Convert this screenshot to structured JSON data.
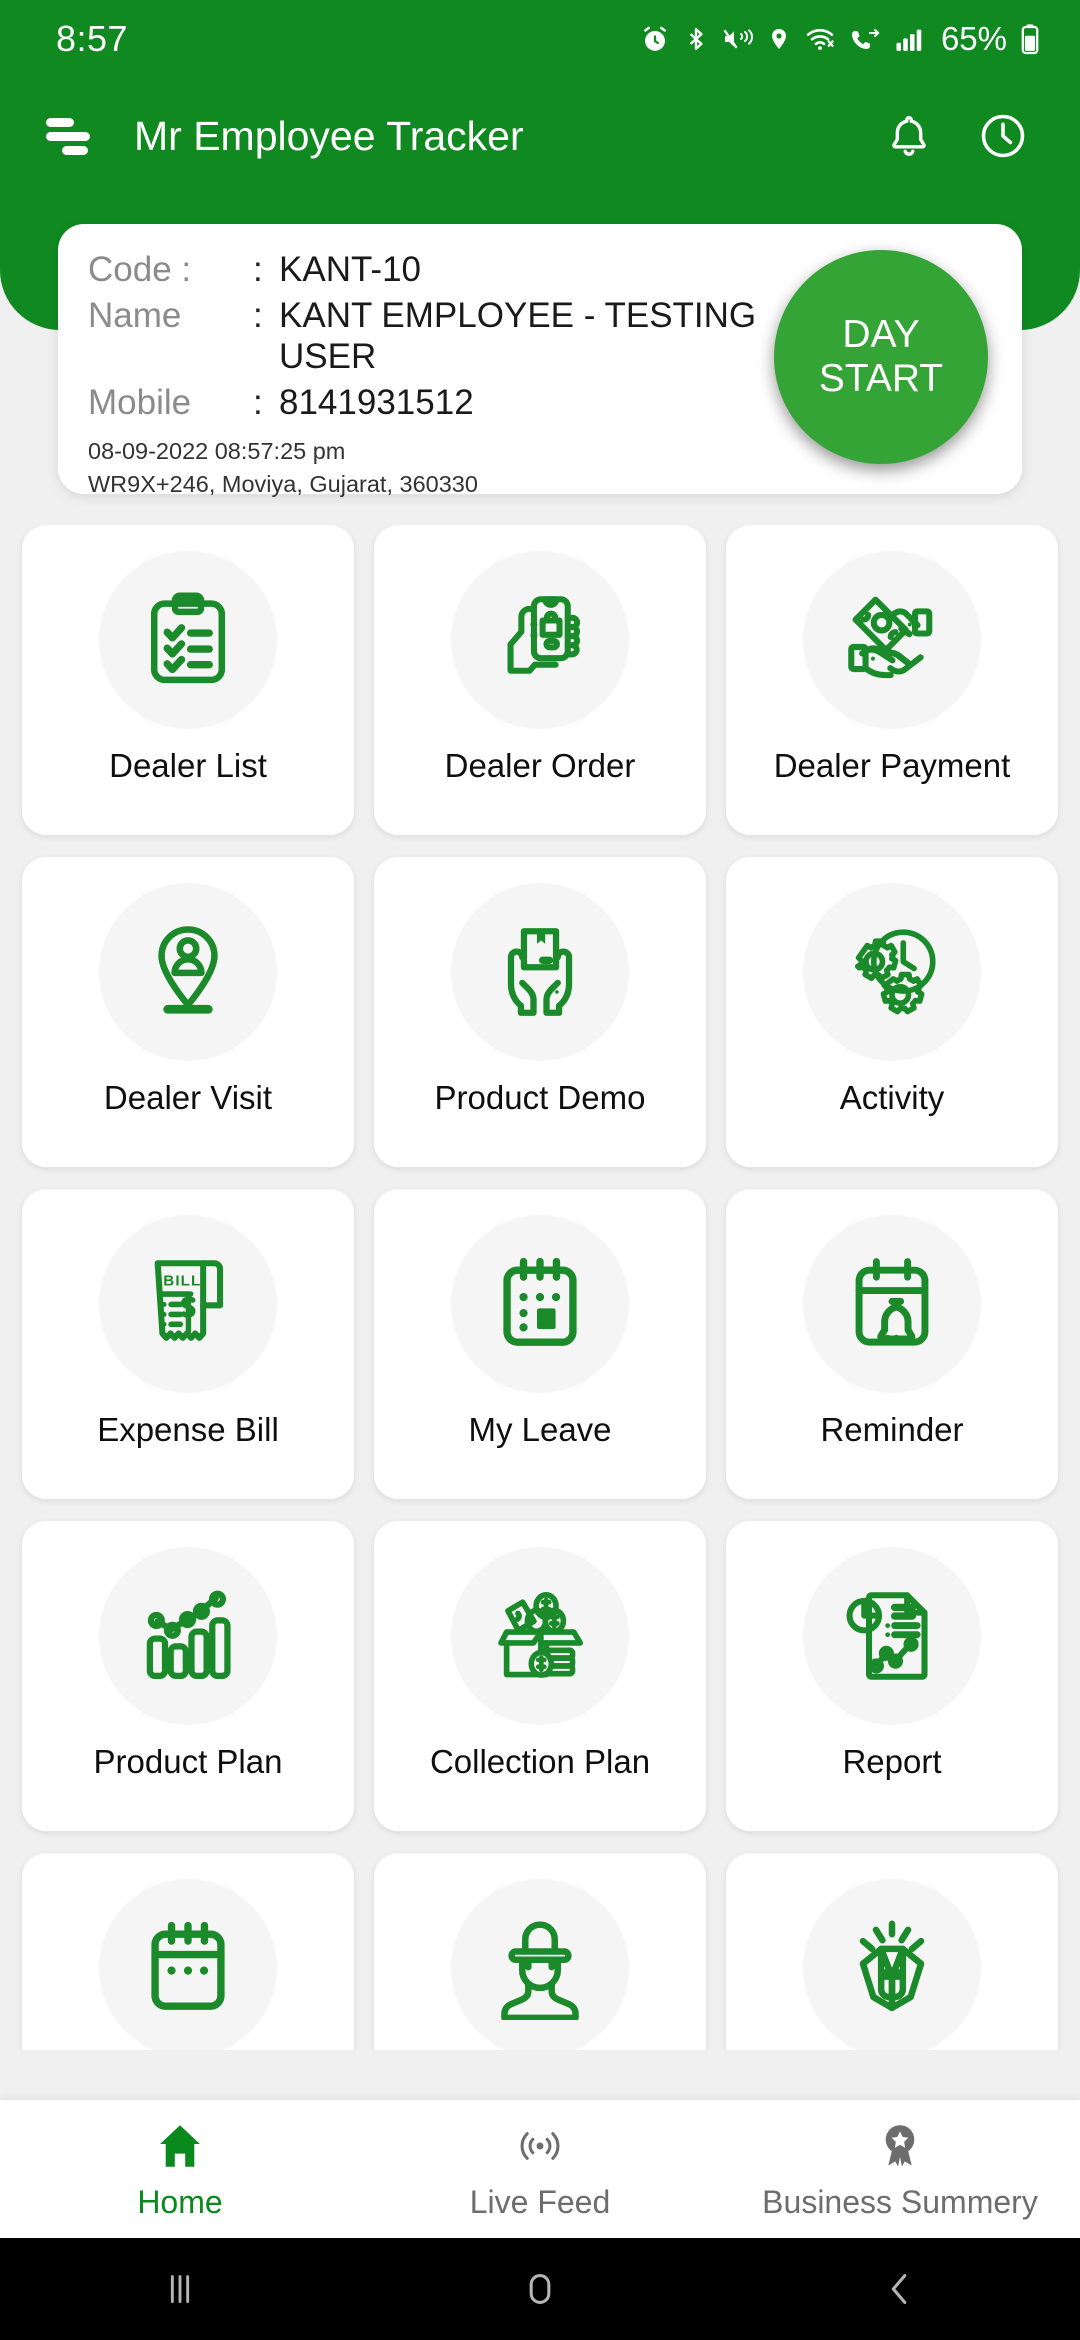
{
  "status_bar": {
    "time": "8:57",
    "battery_percent": "65%",
    "icons": [
      "alarm-icon",
      "bluetooth-icon",
      "mute-vibrate-icon",
      "location-icon",
      "wifi-icon",
      "call-forward-icon",
      "signal-icon",
      "battery-icon"
    ]
  },
  "app_bar": {
    "title": "Mr Employee Tracker",
    "menu_icon": "hamburger-icon",
    "actions": [
      "notification-bell-icon",
      "history-clock-icon"
    ]
  },
  "info_card": {
    "rows": [
      {
        "key": "Code :",
        "sep": ":",
        "value": "KANT-10"
      },
      {
        "key": "Name",
        "sep": ":",
        "value": "KANT EMPLOYEE - TESTING USER"
      },
      {
        "key": "Mobile",
        "sep": ":",
        "value": "8141931512"
      }
    ],
    "timestamp": "08-09-2022 08:57:25 pm",
    "address": "WR9X+246, Moviya, Gujarat, 360330",
    "day_start": {
      "line1": "DAY",
      "line2": "START"
    }
  },
  "grid": {
    "tiles": [
      {
        "label": "Dealer List",
        "icon": "clipboard-checklist-icon"
      },
      {
        "label": "Dealer Order",
        "icon": "hand-phone-shopping-icon"
      },
      {
        "label": "Dealer Payment",
        "icon": "hands-cash-exchange-icon"
      },
      {
        "label": "Dealer Visit",
        "icon": "location-pin-person-icon"
      },
      {
        "label": "Product Demo",
        "icon": "hands-box-icon"
      },
      {
        "label": "Activity",
        "icon": "gears-clock-icon"
      },
      {
        "label": "Expense Bill",
        "icon": "bill-receipt-icon"
      },
      {
        "label": "My Leave",
        "icon": "calendar-dots-icon"
      },
      {
        "label": "Reminder",
        "icon": "calendar-bell-icon"
      },
      {
        "label": "Product Plan",
        "icon": "bar-chart-trend-icon"
      },
      {
        "label": "Collection Plan",
        "icon": "money-box-icon"
      },
      {
        "label": "Report",
        "icon": "report-document-icon"
      },
      {
        "label": "",
        "icon": "calendar-grid-icon"
      },
      {
        "label": "",
        "icon": "person-hat-icon"
      },
      {
        "label": "",
        "icon": "clapping-hands-icon"
      }
    ]
  },
  "bottom_nav": {
    "items": [
      {
        "label": "Home",
        "icon": "home-icon",
        "active": true
      },
      {
        "label": "Live Feed",
        "icon": "broadcast-icon",
        "active": false
      },
      {
        "label": "Business Summery",
        "icon": "award-badge-icon",
        "active": false
      }
    ]
  },
  "android_nav": {
    "items": [
      "recent-apps-icon",
      "home-circle-icon",
      "back-chevron-icon"
    ]
  },
  "colors": {
    "brand_green": "#108a20",
    "accent_green": "#35a436",
    "icon_green": "#1a8a2a",
    "nav_active": "#0a8a1d",
    "nav_inactive": "#6d6d6d"
  }
}
